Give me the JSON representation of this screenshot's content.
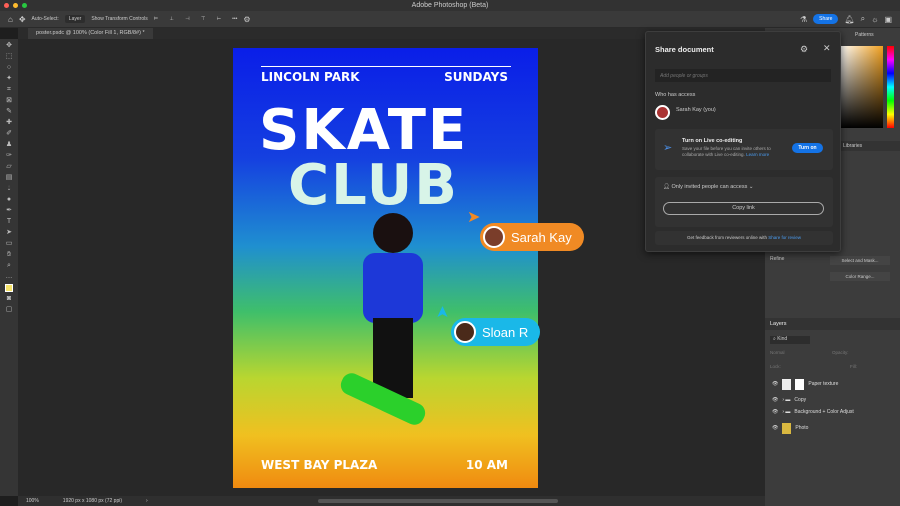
{
  "app": {
    "title": "Adobe Photoshop (Beta)",
    "share_label": "Share"
  },
  "options": {
    "auto_select_label": "Auto-Select:",
    "auto_select_value": "Layer",
    "show_transform_label": "Show Transform Controls",
    "more": "•••"
  },
  "document": {
    "tab_label": "poster.psdc @ 100% (Color Fill 1, RGB/8#) *",
    "zoom": "100%",
    "dimensions": "1920 px x 1080 px (72 ppi)"
  },
  "poster": {
    "top_left": "LINCOLN PARK",
    "top_right": "SUNDAYS",
    "headline_1": "SKATE",
    "headline_2": "CLUB",
    "bottom_left": "WEST BAY PLAZA",
    "bottom_right": "10 AM"
  },
  "collaborators": [
    {
      "name": "Sarah Kay",
      "color": "#f08a24"
    },
    {
      "name": "Sloan R",
      "color": "#1ab8e8"
    }
  ],
  "share_panel": {
    "title": "Share document",
    "input_placeholder": "Add people or groups",
    "who_has_access": "Who has access",
    "owner": "Sarah Kay (you)",
    "coedit_title": "Turn on Live co-editing",
    "coedit_text": "Save your file before you can invite others to collaborate with Live co-editing.",
    "learn_more": "Learn more",
    "turn_on": "Turn on",
    "access_setting": "Only invited people can access",
    "copy_link": "Copy link",
    "feedback_text": "Get feedback from reviewers online with",
    "feedback_link": "Share for review",
    "accent": "#1473e6"
  },
  "right_panel": {
    "tabs": [
      "Patterns",
      "Libraries"
    ],
    "refine_label": "Refine",
    "select_mask_button": "Select and Mask...",
    "color_range_button": "Color Range..."
  },
  "layers": {
    "title": "Layers",
    "filter": "Kind",
    "blend_mode": "Normal",
    "opacity_label": "Opacity:",
    "lock_label": "Lock:",
    "fill_label": "Fill:",
    "items": [
      {
        "name": "Paper texture"
      },
      {
        "name": "Copy"
      },
      {
        "name": "Background + Color Adjust"
      },
      {
        "name": "Photo"
      }
    ]
  }
}
